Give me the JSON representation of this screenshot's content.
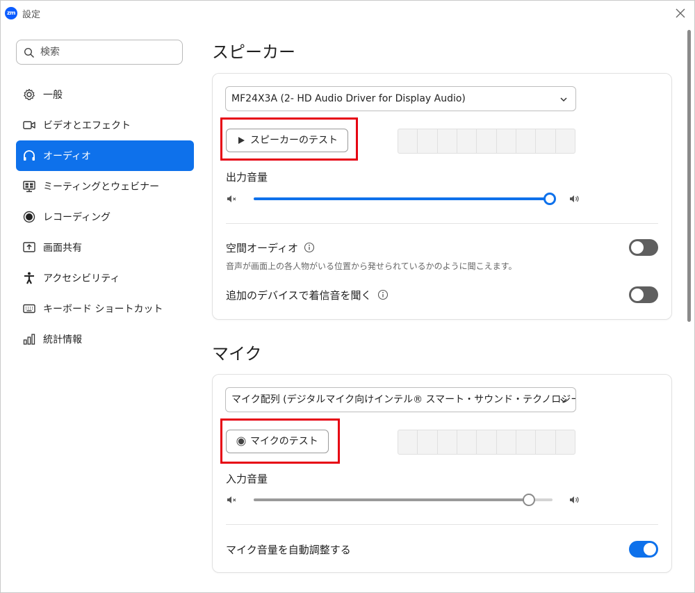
{
  "window": {
    "title": "設定",
    "logo": "zm"
  },
  "search": {
    "placeholder": "検索"
  },
  "sidebar": {
    "items": [
      {
        "label": "一般",
        "icon": "gear-icon"
      },
      {
        "label": "ビデオとエフェクト",
        "icon": "video-camera-icon"
      },
      {
        "label": "オーディオ",
        "icon": "headphones-icon"
      },
      {
        "label": "ミーティングとウェビナー",
        "icon": "meeting-screen-icon"
      },
      {
        "label": "レコーディング",
        "icon": "record-icon"
      },
      {
        "label": "画面共有",
        "icon": "share-screen-icon"
      },
      {
        "label": "アクセシビリティ",
        "icon": "accessibility-icon"
      },
      {
        "label": "キーボード ショートカット",
        "icon": "keyboard-icon"
      },
      {
        "label": "統計情報",
        "icon": "statistics-icon"
      }
    ],
    "active_index": 2
  },
  "speaker": {
    "title": "スピーカー",
    "device": "MF24X3A (2- HD Audio Driver for Display Audio)",
    "test_button": "スピーカーのテスト",
    "volume_label": "出力音量",
    "volume_level": 0.99,
    "spatial_label": "空間オーディオ",
    "spatial_desc": "音声が画面上の各人物がいる位置から発せられているかのように聞こえます。",
    "spatial_on": false,
    "ring_label": "追加のデバイスで着信音を聞く",
    "ring_on": false
  },
  "mic": {
    "title": "マイク",
    "device": "マイク配列 (デジタルマイク向けインテル® スマート・サウンド・テクノロジー)",
    "test_button": "マイクのテスト",
    "volume_label": "入力音量",
    "volume_level": 0.92,
    "auto_label": "マイク音量を自動調整する",
    "auto_on": true
  },
  "colors": {
    "accent": "#0e71eb",
    "highlight": "#e60012",
    "toggle_off": "#5f5f5f"
  }
}
